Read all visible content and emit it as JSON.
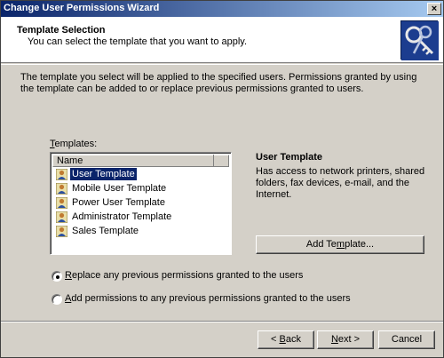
{
  "window": {
    "title": "Change User Permissions Wizard",
    "close_glyph": "×"
  },
  "header": {
    "title": "Template Selection",
    "subtitle": "You can select the template that you want to apply.",
    "icon": "keys-icon"
  },
  "intro": "The template you select will be applied to the specified users. Permissions granted by using the template can be added to or replace previous permissions granted to users.",
  "templates": {
    "label_prefix": "T",
    "label_rest": "emplates:",
    "column_header": "Name",
    "items": [
      {
        "label": "User Template",
        "icon": "user-icon",
        "selected": true
      },
      {
        "label": "Mobile User Template",
        "icon": "user-icon",
        "selected": false
      },
      {
        "label": "Power User Template",
        "icon": "user-icon",
        "selected": false
      },
      {
        "label": "Administrator Template",
        "icon": "user-icon",
        "selected": false
      },
      {
        "label": "Sales Template",
        "icon": "user-icon",
        "selected": false
      }
    ]
  },
  "detail": {
    "title": "User Template",
    "description": "Has access to network printers, shared folders, fax devices, e-mail, and the Internet."
  },
  "add_template": {
    "label_pre": "Add Te",
    "label_mnemonic": "m",
    "label_post": "plate..."
  },
  "options": {
    "replace": {
      "mnemonic": "R",
      "rest": "eplace any previous permissions granted to the users",
      "selected": true
    },
    "add": {
      "mnemonic": "A",
      "rest": "dd permissions to any previous permissions granted to the users",
      "selected": false
    }
  },
  "footer": {
    "back_pre": "< ",
    "back_mnemonic": "B",
    "back_post": "ack",
    "next_mnemonic": "N",
    "next_post": "ext >",
    "cancel": "Cancel"
  },
  "colors": {
    "titlebar_start": "#0a246a",
    "titlebar_end": "#a6caf0",
    "dialog_bg": "#d4d0c8",
    "selection": "#0a246a"
  }
}
